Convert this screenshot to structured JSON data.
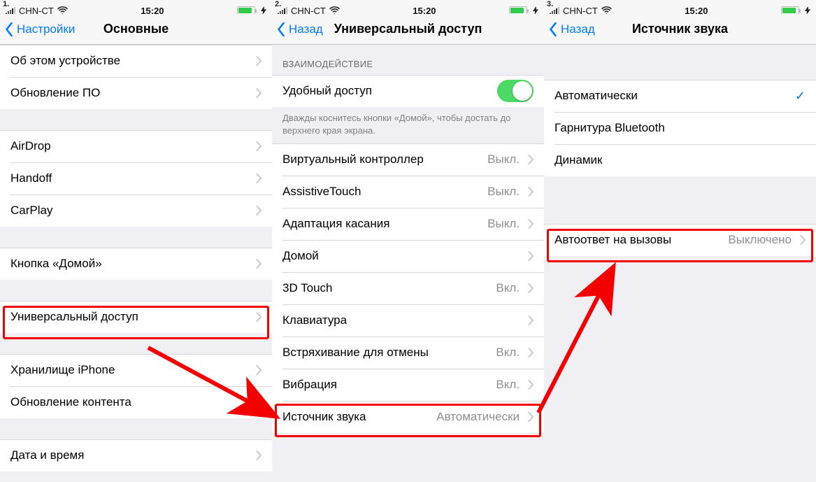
{
  "statusbar": {
    "carrier": "CHN-CT",
    "time": "15:20"
  },
  "steps": [
    {
      "num": "1.",
      "back": "Настройки",
      "title": "Основные",
      "groups": [
        {
          "type": "cells",
          "cells": [
            {
              "label": "Об этом устройстве",
              "chevron": true
            },
            {
              "label": "Обновление ПО",
              "chevron": true
            }
          ]
        },
        {
          "type": "gap"
        },
        {
          "type": "cells",
          "cells": [
            {
              "label": "AirDrop",
              "chevron": true
            },
            {
              "label": "Handoff",
              "chevron": true
            },
            {
              "label": "CarPlay",
              "chevron": true
            }
          ]
        },
        {
          "type": "gap"
        },
        {
          "type": "cells",
          "cells": [
            {
              "label": "Кнопка «Домой»",
              "chevron": true
            }
          ]
        },
        {
          "type": "gap"
        },
        {
          "type": "cells",
          "cells": [
            {
              "label": "Универсальный доступ",
              "chevron": true,
              "highlight": true
            }
          ]
        },
        {
          "type": "gap"
        },
        {
          "type": "cells",
          "cells": [
            {
              "label": "Хранилище iPhone",
              "chevron": true
            },
            {
              "label": "Обновление контента",
              "chevron": true
            }
          ]
        },
        {
          "type": "gap"
        },
        {
          "type": "cells",
          "cells": [
            {
              "label": "Дата и время",
              "chevron": true
            }
          ]
        }
      ]
    },
    {
      "num": "2.",
      "back": "Назад",
      "title": "Универсальный доступ",
      "groups": [
        {
          "type": "header",
          "text": "ВЗАИМОДЕЙСТВИЕ"
        },
        {
          "type": "cells",
          "cells": [
            {
              "label": "Удобный доступ",
              "switch": true
            }
          ]
        },
        {
          "type": "footer",
          "text": "Дважды коснитесь кнопки «Домой», чтобы достать до верхнего края экрана."
        },
        {
          "type": "cells",
          "cells": [
            {
              "label": "Виртуальный контроллер",
              "value": "Выкл.",
              "chevron": true
            },
            {
              "label": "AssistiveTouch",
              "value": "Выкл.",
              "chevron": true
            },
            {
              "label": "Адаптация касания",
              "value": "Выкл.",
              "chevron": true
            },
            {
              "label": "Домой",
              "chevron": true
            },
            {
              "label": "3D Touch",
              "value": "Вкл.",
              "chevron": true
            },
            {
              "label": "Клавиатура",
              "chevron": true
            },
            {
              "label": "Встряхивание для отмены",
              "value": "Вкл.",
              "chevron": true
            },
            {
              "label": "Вибрация",
              "value": "Вкл.",
              "chevron": true
            },
            {
              "label": "Источник звука",
              "value": "Автоматически",
              "chevron": true,
              "highlight": true
            }
          ]
        }
      ]
    },
    {
      "num": "3.",
      "back": "Назад",
      "title": "Источник звука",
      "groups": [
        {
          "type": "spacer"
        },
        {
          "type": "cells",
          "cells": [
            {
              "label": "Автоматически",
              "check": true
            },
            {
              "label": "Гарнитура Bluetooth"
            },
            {
              "label": "Динамик"
            }
          ]
        },
        {
          "type": "bigspacer"
        },
        {
          "type": "cells",
          "cells": [
            {
              "label": "Автоответ на вызовы",
              "value": "Выключено",
              "chevron": true,
              "highlight": true
            }
          ]
        }
      ]
    }
  ]
}
